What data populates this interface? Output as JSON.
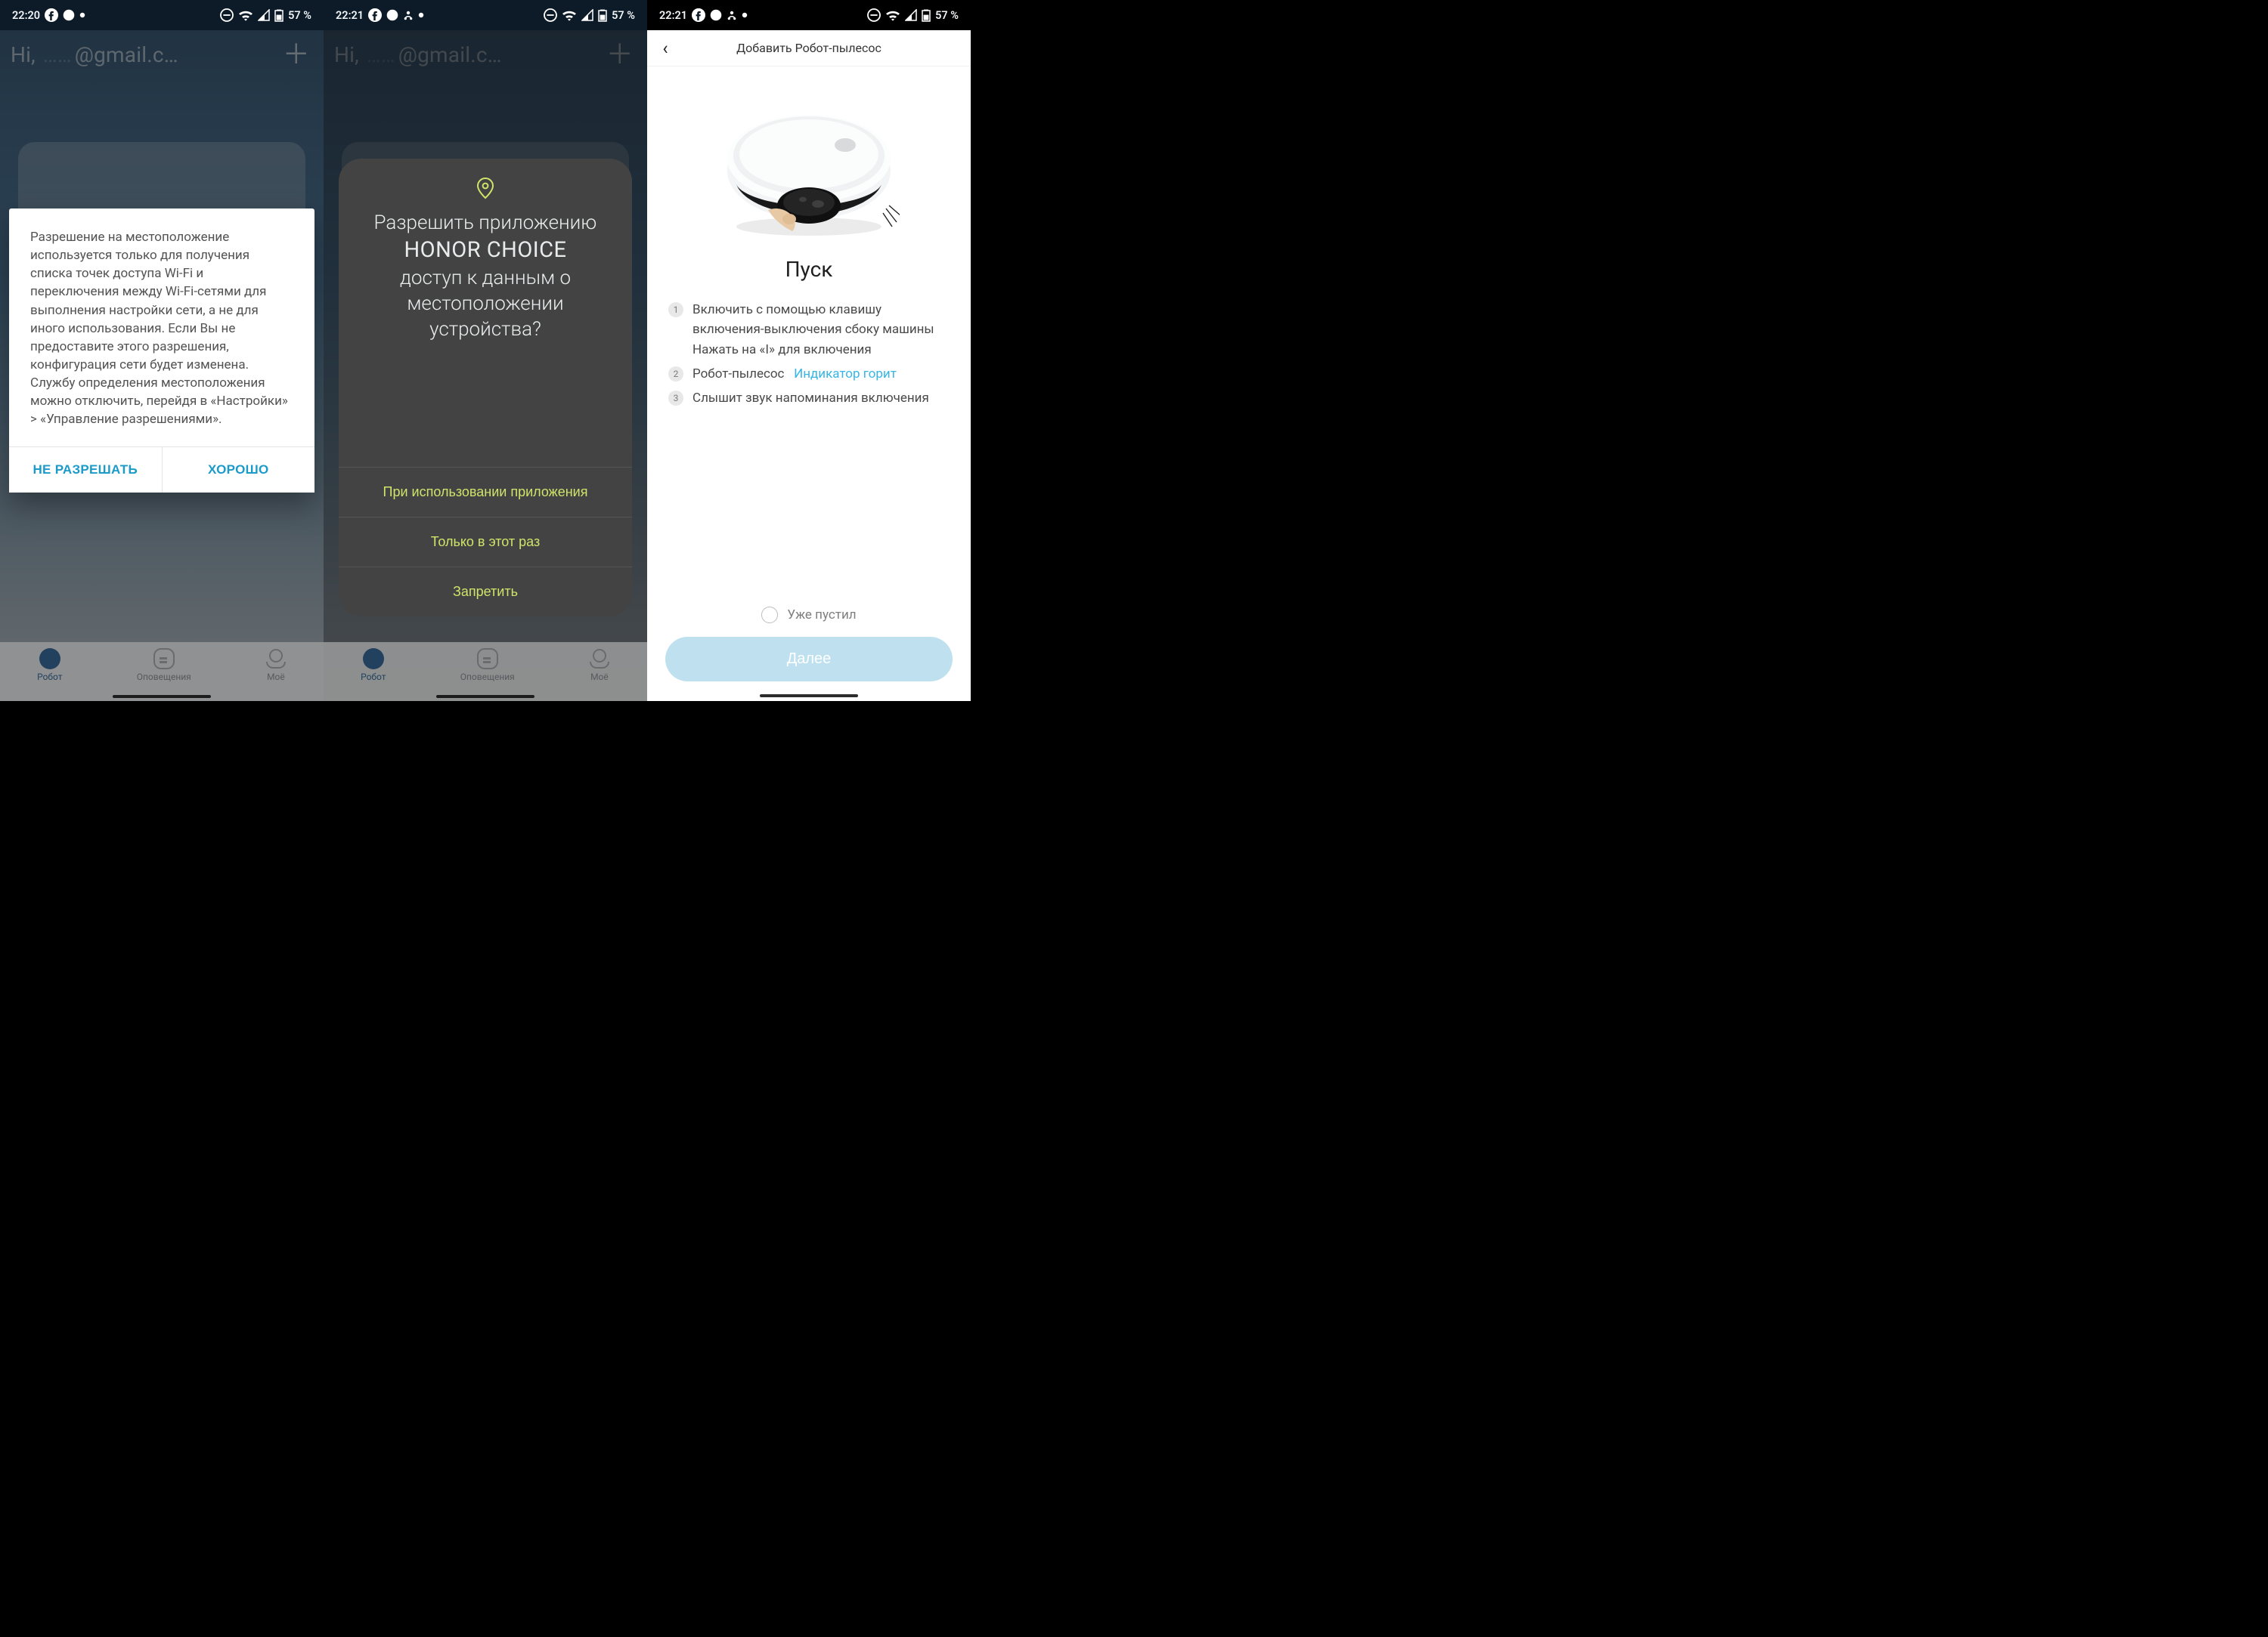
{
  "screen1": {
    "status": {
      "time": "22:20",
      "battery": "57 %"
    },
    "bg": {
      "greeting_prefix": "Hi,",
      "email_mask": "@gmail.c…"
    },
    "dialog": {
      "body": "Разрешение на местоположение используется только для получения списка точек доступа Wi-Fi и переключения между Wi-Fi-сетями для выполнения настройки сети, а не для иного использования. Если Вы не предоставите этого разрешения, конфигурация сети будет изменена. Службу определения местоположения можно отключить, перейдя в «Настройки» > «Управление разрешениями».",
      "deny": "НЕ РАЗРЕШАТЬ",
      "ok": "ХОРОШО"
    },
    "nav": {
      "robot": "Робот",
      "alerts": "Оповещения",
      "mine": "Моё"
    }
  },
  "screen2": {
    "status": {
      "time": "22:21",
      "battery": "57 %"
    },
    "bg": {
      "greeting_prefix": "Hi,",
      "email_mask": "@gmail.c…"
    },
    "perm": {
      "line1": "Разрешить приложению",
      "brand": "HONOR CHOICE",
      "line2": "доступ к данным о местоположении устройства?",
      "opt_while": "При использовании приложения",
      "opt_once": "Только в этот раз",
      "opt_deny": "Запретить"
    },
    "nav": {
      "robot": "Робот",
      "alerts": "Оповещения",
      "mine": "Моё"
    }
  },
  "screen3": {
    "status": {
      "time": "22:21",
      "battery": "57 %"
    },
    "header": "Добавить Робот-пылесос",
    "heading": "Пуск",
    "steps": {
      "s1a": "Включить с помощью клавишу включения-выключения сбоку машины",
      "s1b": "Нажать на «I» для включения",
      "s2_text": "Робот-пылесос",
      "s2_link": "Индикатор горит",
      "s3": "Слышит звук напоминания включения"
    },
    "checkbox_label": "Уже пустил",
    "next": "Далее"
  }
}
